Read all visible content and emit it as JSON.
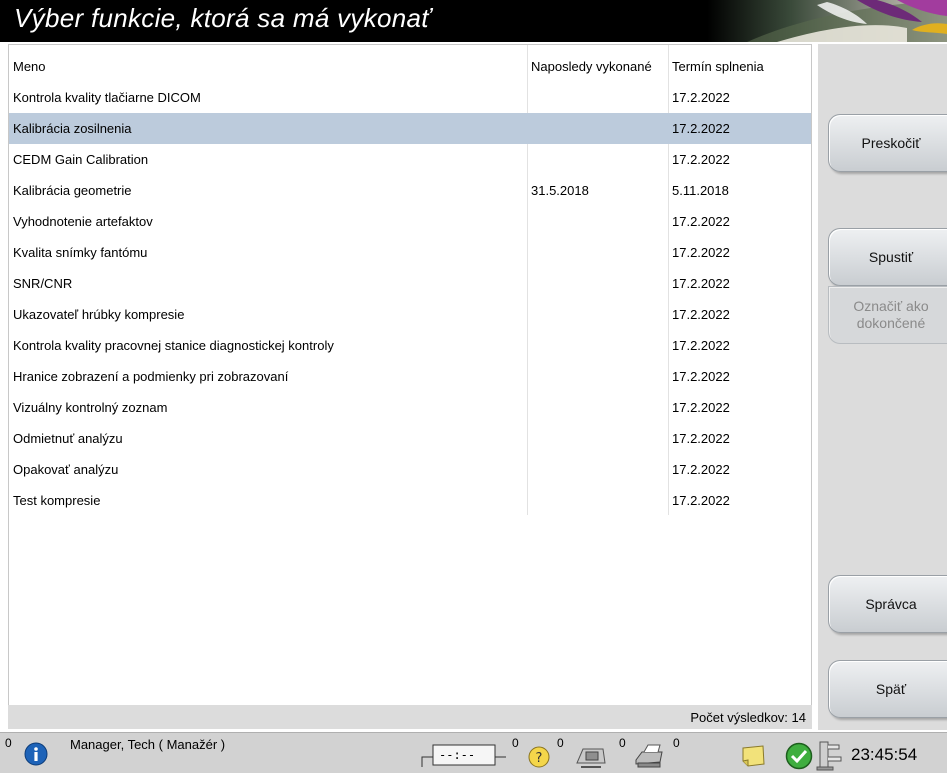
{
  "header": {
    "title": "Výber funkcie, ktorá sa má vykonať"
  },
  "table": {
    "columns": [
      "Meno",
      "Naposledy vykonané",
      "Termín splnenia"
    ],
    "selected_index": 1,
    "rows": [
      {
        "name": "Kontrola kvality tlačiarne DICOM",
        "last": "",
        "due": "17.2.2022"
      },
      {
        "name": "Kalibrácia zosilnenia",
        "last": "",
        "due": "17.2.2022"
      },
      {
        "name": "CEDM Gain Calibration",
        "last": "",
        "due": "17.2.2022"
      },
      {
        "name": "Kalibrácia geometrie",
        "last": "31.5.2018",
        "due": "5.11.2018"
      },
      {
        "name": "Vyhodnotenie artefaktov",
        "last": "",
        "due": "17.2.2022"
      },
      {
        "name": "Kvalita snímky fantómu",
        "last": "",
        "due": "17.2.2022"
      },
      {
        "name": "SNR/CNR",
        "last": "",
        "due": "17.2.2022"
      },
      {
        "name": "Ukazovateľ hrúbky kompresie",
        "last": "",
        "due": "17.2.2022"
      },
      {
        "name": "Kontrola kvality pracovnej stanice diagnostickej kontroly",
        "last": "",
        "due": "17.2.2022"
      },
      {
        "name": "Hranice zobrazení a podmienky pri zobrazovaní",
        "last": "",
        "due": "17.2.2022"
      },
      {
        "name": "Vizuálny kontrolný zoznam",
        "last": "",
        "due": "17.2.2022"
      },
      {
        "name": "Odmietnuť analýzu",
        "last": "",
        "due": "17.2.2022"
      },
      {
        "name": "Opakovať analýzu",
        "last": "",
        "due": "17.2.2022"
      },
      {
        "name": "Test kompresie",
        "last": "",
        "due": "17.2.2022"
      }
    ],
    "result_count": "Počet výsledkov: 14"
  },
  "sidebar": {
    "skip": "Preskočiť",
    "start": "Spustiť",
    "mark_done": "Označiť ako dokončené",
    "admin": "Správca",
    "back": "Späť"
  },
  "statusbar": {
    "alerts_count": "0",
    "user": "Manager, Tech ( Manažér )",
    "timer": "--:--",
    "timer_count": "0",
    "help_count": "0",
    "detector_count": "0",
    "printer_count": "0",
    "clock": "23:45:54",
    "accent": "#1e63b8"
  }
}
